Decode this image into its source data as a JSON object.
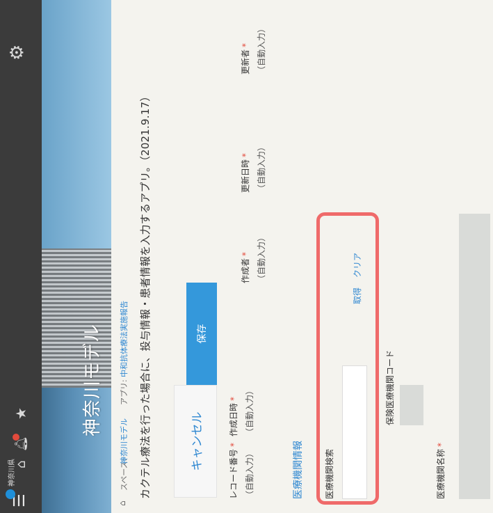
{
  "header": {
    "logo_text": "神奈川県",
    "icons": [
      "menu-icon",
      "home-icon",
      "bell-icon",
      "star-icon",
      "gear-icon"
    ],
    "accent_color": "#3b3b3b",
    "notification_color": "#e24a3c"
  },
  "banner": {
    "title": "神奈川モデル"
  },
  "breadcrumb": {
    "space_label": "スペース:",
    "space_name": "神奈川モデル",
    "app_label": "アプリ:",
    "app_name": "中和抗体療法実施報告"
  },
  "description": "カクテル療法を行った場合に、投与情報・患者情報を入力するアプリ。（2021.9.17）",
  "buttons": {
    "cancel": "キャンセル",
    "save": "保存",
    "save_color": "#3498db"
  },
  "fields": {
    "record_number": {
      "label": "レコード番号",
      "value": "（自動入力）"
    },
    "created_at": {
      "label": "作成日時",
      "value": "（自動入力）"
    },
    "creator": {
      "label": "作成者",
      "value": "（自動入力）"
    },
    "updated_at": {
      "label": "更新日時",
      "value": "（自動入力）"
    },
    "updater": {
      "label": "更新者",
      "value": "（自動入力）"
    },
    "required_mark": "*"
  },
  "section": {
    "title": "医療機関情報",
    "lookup_label": "医療機関検索",
    "lookup_value": "",
    "fetch": "取得",
    "clear": "クリア",
    "insurance_code_label": "保険医療機関コード",
    "institution_name_label": "医療機関名称",
    "highlight_color": "#ef6a6a"
  }
}
